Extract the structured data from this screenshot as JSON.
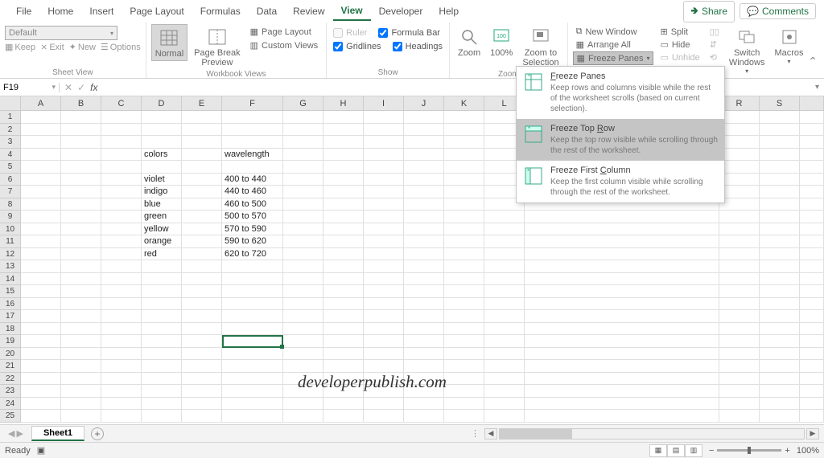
{
  "menubar": {
    "items": [
      "File",
      "Home",
      "Insert",
      "Page Layout",
      "Formulas",
      "Data",
      "Review",
      "View",
      "Developer",
      "Help"
    ],
    "active_index": 7,
    "share": "Share",
    "comments": "Comments"
  },
  "ribbon": {
    "sheet_view": {
      "combo": "Default",
      "keep": "Keep",
      "exit": "Exit",
      "new": "New",
      "options": "Options",
      "label": "Sheet View"
    },
    "workbook_views": {
      "normal": "Normal",
      "page_break": "Page Break\nPreview",
      "page_layout": "Page Layout",
      "custom_views": "Custom Views",
      "label": "Workbook Views"
    },
    "show": {
      "ruler": "Ruler",
      "formula_bar": "Formula Bar",
      "gridlines": "Gridlines",
      "headings": "Headings",
      "label": "Show"
    },
    "zoom": {
      "zoom": "Zoom",
      "p100": "100%",
      "zoom_to_sel": "Zoom to\nSelection",
      "label": "Zoom"
    },
    "window": {
      "new_window": "New Window",
      "arrange_all": "Arrange All",
      "freeze_panes": "Freeze Panes",
      "split": "Split",
      "hide": "Hide",
      "unhide": "Unhide",
      "switch_windows": "Switch\nWindows",
      "macros": "Macros"
    }
  },
  "freeze_menu": {
    "opt1": {
      "title_pre": "",
      "title_ul": "F",
      "title_post": "reeze Panes",
      "desc": "Keep rows and columns visible while the rest of the worksheet scrolls (based on current selection)."
    },
    "opt2": {
      "title_pre": "Freeze Top ",
      "title_ul": "R",
      "title_post": "ow",
      "desc": "Keep the top row visible while scrolling through the rest of the worksheet."
    },
    "opt3": {
      "title_pre": "Freeze First ",
      "title_ul": "C",
      "title_post": "olumn",
      "desc": "Keep the first column visible while scrolling through the rest of the worksheet."
    }
  },
  "name_box": "F19",
  "columns": [
    "A",
    "B",
    "C",
    "D",
    "E",
    "F",
    "G",
    "H",
    "I",
    "J",
    "K",
    "L",
    "",
    "R",
    "S",
    ""
  ],
  "cells": {
    "D4": "colors",
    "F4": "wavelength",
    "D6": "violet",
    "F6": "400 to 440",
    "D7": "indigo",
    "F7": "440 to 460",
    "D8": "blue",
    "F8": "460 to 500",
    "D9": "green",
    "F9": "500 to 570",
    "D10": "yellow",
    "F10": "570 to 590",
    "D11": "orange",
    "F11": "590 to 620",
    "D12": "red",
    "F12": "620 to 720"
  },
  "watermark": "developerpublish.com",
  "sheet_tab": "Sheet1",
  "status": {
    "ready": "Ready",
    "zoom": "100%"
  }
}
